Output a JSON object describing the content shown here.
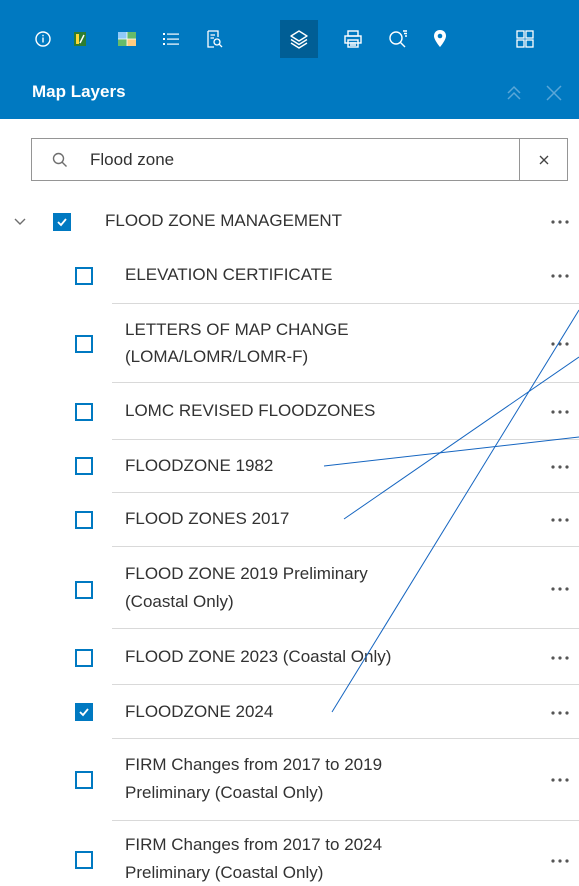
{
  "toolbar": {
    "buttons": [
      {
        "name": "info-icon"
      },
      {
        "name": "legend-icon"
      },
      {
        "name": "basemap-icon"
      },
      {
        "name": "list-icon"
      },
      {
        "name": "search-document-icon"
      },
      {
        "name": "layers-icon",
        "active": true
      },
      {
        "name": "print-icon"
      },
      {
        "name": "query-icon"
      },
      {
        "name": "location-pin-icon"
      },
      {
        "name": "app-grid-icon"
      }
    ]
  },
  "panel": {
    "title": "Map Layers"
  },
  "search": {
    "value": "Flood zone"
  },
  "group": {
    "label": "FLOOD ZONE MANAGEMENT",
    "checked": true,
    "expanded": true
  },
  "layers": [
    {
      "label": "ELEVATION CERTIFICATE",
      "checked": false
    },
    {
      "label": "LETTERS OF MAP CHANGE",
      "label2": "(LOMA/LOMR/LOMR-F)",
      "checked": false
    },
    {
      "label": "LOMC REVISED FLOODZONES",
      "checked": false
    },
    {
      "label": "FLOODZONE 1982",
      "checked": false
    },
    {
      "label": "FLOOD ZONES 2017",
      "checked": false
    },
    {
      "label": "FLOOD ZONE 2019 Preliminary",
      "label2": "(Coastal Only)",
      "checked": false
    },
    {
      "label": "FLOOD ZONE 2023 (Coastal Only)",
      "checked": false
    },
    {
      "label": "FLOODZONE 2024",
      "checked": true
    },
    {
      "label": "FIRM Changes from 2017 to 2019",
      "label2": "Preliminary (Coastal Only)",
      "checked": false
    },
    {
      "label": "FIRM Changes from 2017 to 2024",
      "label2": "Preliminary (Coastal Only)",
      "checked": false
    }
  ],
  "colors": {
    "brand": "#0079c1",
    "active_button": "#005e95",
    "annotation_line": "#1565c0"
  }
}
